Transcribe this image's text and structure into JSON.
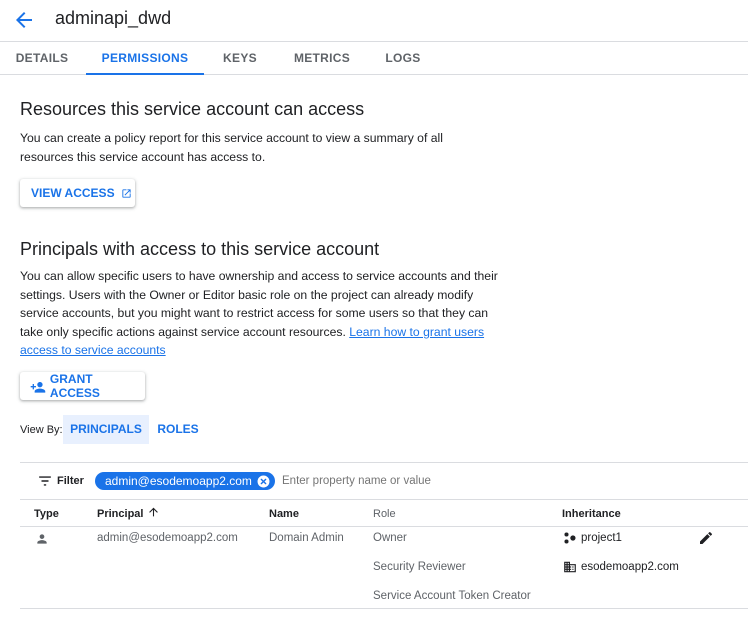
{
  "header": {
    "title": "adminapi_dwd"
  },
  "tabs": [
    {
      "label": "DETAILS"
    },
    {
      "label": "PERMISSIONS"
    },
    {
      "label": "KEYS"
    },
    {
      "label": "METRICS"
    },
    {
      "label": "LOGS"
    }
  ],
  "resources": {
    "heading": "Resources this service account can access",
    "line1": "You can create a policy report for this service account to view a summary of all",
    "line2": "resources this service account has access to.",
    "view_access_label": "VIEW ACCESS"
  },
  "principals": {
    "heading": "Principals with access to this service account",
    "line1": "You can allow specific users to have ownership and access to service accounts and their",
    "line2": "settings. Users with the Owner or Editor basic role on the project can already modify",
    "line3": "service accounts, but you might want to restrict access for some users so that they can",
    "line4": "take only specific actions against service account resources.",
    "link_part1": "Learn how to grant users",
    "link_part2": "access to service accounts",
    "grant_access_label": "GRANT ACCESS"
  },
  "view_by": {
    "label": "View By:",
    "options": [
      "PRINCIPALS",
      "ROLES"
    ]
  },
  "filter": {
    "label": "Filter",
    "chip_value": "admin@esodemoapp2.com",
    "placeholder": "Enter property name or value"
  },
  "table": {
    "columns": [
      "Type",
      "Principal",
      "Name",
      "Role",
      "Inheritance"
    ],
    "row": {
      "principal": "admin@esodemoapp2.com",
      "name": "Domain Admin",
      "roles": [
        "Owner",
        "Security Reviewer",
        "Service Account Token Creator"
      ],
      "inheritance": [
        "project1",
        "esodemoapp2.com"
      ]
    }
  }
}
